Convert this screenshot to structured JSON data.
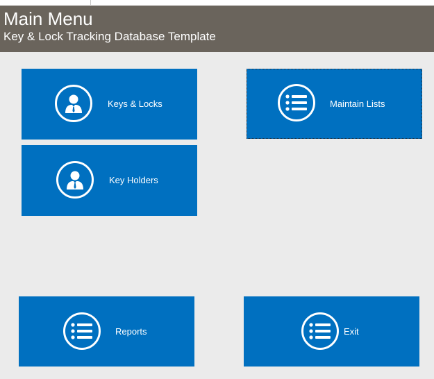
{
  "header": {
    "title": "Main Menu",
    "subtitle": "Key & Lock Tracking Database Template",
    "background": "#6a645c"
  },
  "accent_color": "#0070c0",
  "buttons": {
    "keys_locks": {
      "label": "Keys & Locks",
      "icon": "person-icon"
    },
    "key_holders": {
      "label": "Key Holders",
      "icon": "person-icon"
    },
    "maintain_lists": {
      "label": "Maintain Lists",
      "icon": "list-icon"
    },
    "reports": {
      "label": "Reports",
      "icon": "list-icon"
    },
    "exit": {
      "label": "Exit",
      "icon": "list-icon"
    }
  }
}
